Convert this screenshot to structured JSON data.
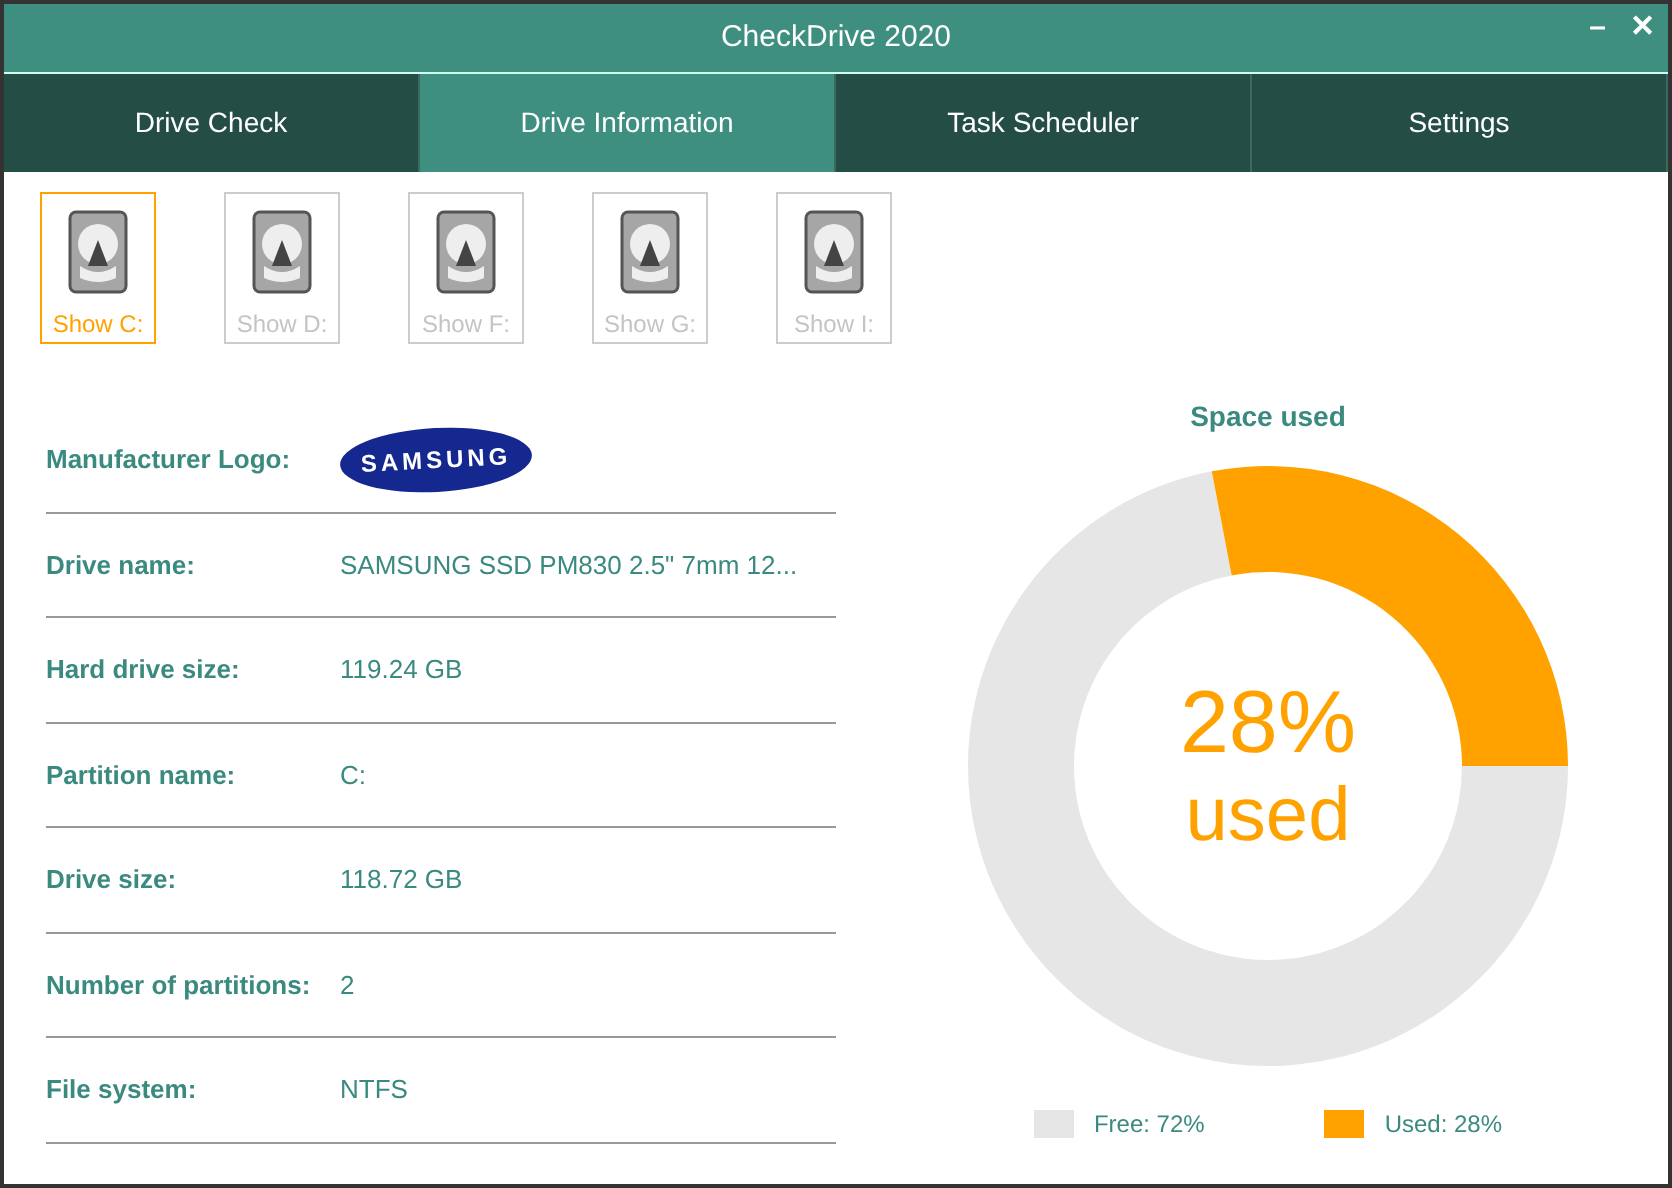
{
  "window": {
    "title": "CheckDrive 2020",
    "controls": [
      "–",
      "✕"
    ]
  },
  "tabs": [
    {
      "label": "Drive Check",
      "selected": false
    },
    {
      "label": "Drive Information",
      "selected": true
    },
    {
      "label": "Task Scheduler",
      "selected": false
    },
    {
      "label": "Settings",
      "selected": false
    }
  ],
  "drives": [
    {
      "label": "Show C:",
      "selected": true
    },
    {
      "label": "Show D:",
      "selected": false
    },
    {
      "label": "Show F:",
      "selected": false
    },
    {
      "label": "Show G:",
      "selected": false
    },
    {
      "label": "Show I:",
      "selected": false
    }
  ],
  "info_rows": [
    {
      "kind": "logo",
      "label": "Manufacturer Logo:",
      "value": "SAMSUNG"
    },
    {
      "kind": "text",
      "label": "Drive name:",
      "value": "SAMSUNG SSD PM830 2.5\" 7mm 12..."
    },
    {
      "kind": "text",
      "label": "Hard drive size:",
      "value": "119.24 GB"
    },
    {
      "kind": "text",
      "label": "Partition name:",
      "value": "C:"
    },
    {
      "kind": "text",
      "label": "Drive size:",
      "value": "118.72 GB"
    },
    {
      "kind": "text",
      "label": "Number of partitions:",
      "value": "2"
    },
    {
      "kind": "text",
      "label": "File system:",
      "value": "NTFS"
    }
  ],
  "space_chart": {
    "center_value": "28%",
    "center_label": "used",
    "chart_data": {
      "type": "donut",
      "title": "Space used",
      "values": [
        72,
        28
      ]
    },
    "legend": [
      {
        "label": "Free: 72%",
        "color": "#e6e6e6"
      },
      {
        "label": "Used: 28%",
        "color": "#ffa200"
      }
    ]
  }
}
